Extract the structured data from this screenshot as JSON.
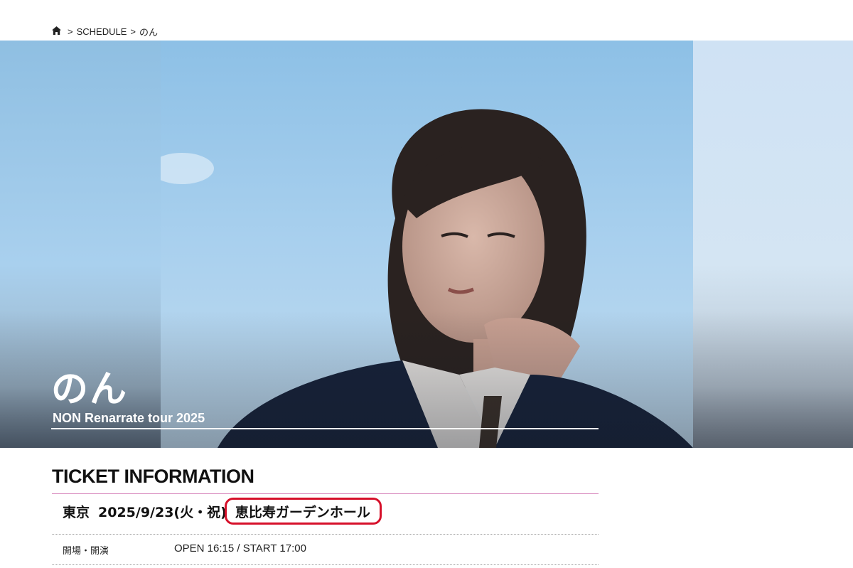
{
  "breadcrumb": {
    "home_icon": "home-icon",
    "separator": ">",
    "items": [
      "SCHEDULE",
      "のん"
    ]
  },
  "hero": {
    "artist": "のん",
    "tour": "NON Renarrate tour 2025"
  },
  "ticket": {
    "section_title": "TICKET INFORMATION",
    "event": {
      "city": "東京",
      "date": "2025/9/23(火・祝)",
      "venue": "恵比寿ガーデンホール"
    },
    "rows": [
      {
        "label": "開場・開演",
        "value": "OPEN 16:15 / START 17:00"
      }
    ]
  },
  "colors": {
    "accent_rule": "#d98cbf",
    "highlight": "#d6102a"
  }
}
